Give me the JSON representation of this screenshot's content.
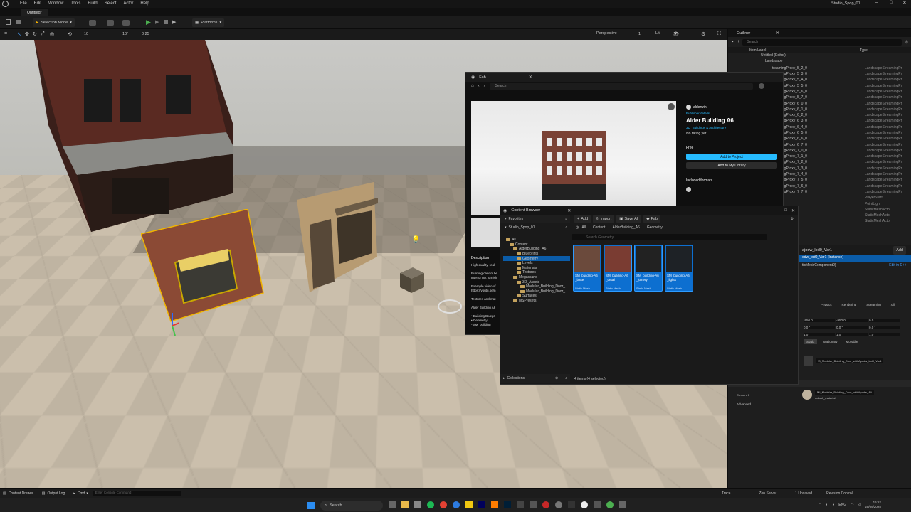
{
  "window": {
    "title": "Studio_Spop_01",
    "tab": "Untitled*"
  },
  "menu": [
    "File",
    "Edit",
    "Window",
    "Tools",
    "Build",
    "Select",
    "Actor",
    "Help"
  ],
  "toolbar": {
    "selection_mode": "Selection Mode",
    "platforms": "Platforms"
  },
  "viewport_toolbar": {
    "perspective": "Perspective",
    "lit": "Lit",
    "grid_snap": "10",
    "rot_snap": "10°",
    "scale_snap": "0.25",
    "camera_speed": "1"
  },
  "outliner": {
    "tab": "Outliner",
    "search_placeholder": "Search",
    "col_label": "Item Label",
    "col_type": "Type",
    "tree": [
      "Untitled (Editor)",
      "Landscape"
    ],
    "rows": [
      {
        "label": "treamingProxy_5_2_0",
        "type": "LandscapeStreamingPr"
      },
      {
        "label": "treamingProxy_5_3_0",
        "type": "LandscapeStreamingPr"
      },
      {
        "label": "treamingProxy_5_4_0",
        "type": "LandscapeStreamingPr"
      },
      {
        "label": "treamingProxy_5_5_0",
        "type": "LandscapeStreamingPr"
      },
      {
        "label": "treamingProxy_5_6_0",
        "type": "LandscapeStreamingPr"
      },
      {
        "label": "treamingProxy_5_7_0",
        "type": "LandscapeStreamingPr"
      },
      {
        "label": "treamingProxy_6_0_0",
        "type": "LandscapeStreamingPr"
      },
      {
        "label": "treamingProxy_6_1_0",
        "type": "LandscapeStreamingPr"
      },
      {
        "label": "treamingProxy_6_2_0",
        "type": "LandscapeStreamingPr"
      },
      {
        "label": "treamingProxy_6_3_0",
        "type": "LandscapeStreamingPr"
      },
      {
        "label": "treamingProxy_6_4_0",
        "type": "LandscapeStreamingPr"
      },
      {
        "label": "treamingProxy_6_5_0",
        "type": "LandscapeStreamingPr"
      },
      {
        "label": "treamingProxy_6_6_0",
        "type": "LandscapeStreamingPr"
      },
      {
        "label": "treamingProxy_6_7_0",
        "type": "LandscapeStreamingPr"
      },
      {
        "label": "treamingProxy_7_0_0",
        "type": "LandscapeStreamingPr"
      },
      {
        "label": "treamingProxy_7_1_0",
        "type": "LandscapeStreamingPr"
      },
      {
        "label": "treamingProxy_7_2_0",
        "type": "LandscapeStreamingPr"
      },
      {
        "label": "treamingProxy_7_3_0",
        "type": "LandscapeStreamingPr"
      },
      {
        "label": "treamingProxy_7_4_0",
        "type": "LandscapeStreamingPr"
      },
      {
        "label": "treamingProxy_7_5_0",
        "type": "LandscapeStreamingPr"
      },
      {
        "label": "treamingProxy_7_6_0",
        "type": "LandscapeStreamingPr"
      },
      {
        "label": "treamingProxy_7_7_0",
        "type": "LandscapeStreamingPr"
      },
      {
        "label": "",
        "type": "PlayerStart"
      },
      {
        "label": "",
        "type": "PointLight"
      },
      {
        "label": "ase",
        "type": "StaticMeshActor"
      },
      {
        "label": "etail",
        "type": "StaticMeshActor"
      },
      {
        "label": "oinery",
        "type": "StaticMeshActor"
      }
    ]
  },
  "details": {
    "title": "ajodw_lod0_Var1",
    "add": "Add",
    "instance": "odw_lod0_Var1 (Instance)",
    "component": "ticMeshComponent0)",
    "edit_cpp": "Edit in C++",
    "tabs": [
      "Physics",
      "Rendering",
      "Streaming",
      "All"
    ],
    "location": [
      "-950.0",
      "-950.0",
      "0.0"
    ],
    "rotation": [
      "0.0 °",
      "0.0 °",
      "0.0 °"
    ],
    "scale": [
      "1.0",
      "1.0",
      "1.0"
    ],
    "mobility": [
      "Static",
      "Stationary",
      "Movable"
    ],
    "mesh": "S_Modular_Building_Door_withApodw_lod0_Var1",
    "materials_header": "Materials",
    "element": "Element 0",
    "material": "MI_Modular_Building_Door_withApodw_Ali",
    "default_material": "default_material",
    "advanced": "Advanced"
  },
  "fab": {
    "title": "Fab",
    "search_placeholder": "Search",
    "publisher": "alderwin",
    "publisher_link": "Publisher details",
    "product": "Alder Building A6",
    "category_3d": "3D",
    "category": "Buildings & Architecture",
    "rating": "No rating yet",
    "price": "Free",
    "add_project": "Add to Project",
    "add_library": "Add to My Library",
    "included_formats": "Included formats",
    "desc_header": "Description",
    "desc_lines": [
      "High quality, reali",
      "",
      "Building cannot be",
      "Interior not furnish",
      "",
      "Example video of",
      "https://youtu.be/n",
      "",
      "Textures and mat",
      "",
      "Alder Building A6",
      "",
      "• Building Bluepr",
      "• Geometry:",
      "  - SM_building_"
    ]
  },
  "content_browser": {
    "title": "Content Browser",
    "add": "Add",
    "import": "Import",
    "save_all": "Save All",
    "fab": "Fab",
    "favorites": "Favorites",
    "project": "Studio_Spop_01",
    "breadcrumb": [
      "All",
      "Content",
      "AlderBuilding_A6",
      "Geometry"
    ],
    "search_placeholder": "Search Geometry",
    "tree": [
      {
        "label": "All",
        "depth": 0
      },
      {
        "label": "Content",
        "depth": 1
      },
      {
        "label": "AlderBuilding_A6",
        "depth": 2
      },
      {
        "label": "Blueprints",
        "depth": 3
      },
      {
        "label": "Geometry",
        "depth": 3,
        "selected": true
      },
      {
        "label": "Levels",
        "depth": 3
      },
      {
        "label": "Materials",
        "depth": 3
      },
      {
        "label": "Textures",
        "depth": 3
      },
      {
        "label": "Megascans",
        "depth": 2
      },
      {
        "label": "3D_Assets",
        "depth": 3
      },
      {
        "label": "Modular_Building_Door_",
        "depth": 4
      },
      {
        "label": "Modular_Building_Door_",
        "depth": 4
      },
      {
        "label": "Surfaces",
        "depth": 3
      },
      {
        "label": "MSPresets",
        "depth": 2
      }
    ],
    "assets": [
      {
        "name": "SM_building-A6 _base",
        "type": "Static Mesh"
      },
      {
        "name": "SM_building-A6 _detail",
        "type": "Static Mesh"
      },
      {
        "name": "SM_building-A6 _joinery",
        "type": "Static Mesh"
      },
      {
        "name": "SM_building-A6 _lights",
        "type": "Static Mesh"
      }
    ],
    "collections": "Collections",
    "status": "4 items (4 selected)"
  },
  "statusbar": {
    "content_drawer": "Content Drawer",
    "output_log": "Output Log",
    "cmd": "Cmd",
    "console_placeholder": "Enter Console Command",
    "trace": "Trace",
    "zen": "Zen Server",
    "unsaved": "1 Unsaved",
    "revision": "Revision Control"
  },
  "taskbar": {
    "search": "Search",
    "lang": "ENG",
    "time": "16:52",
    "date": "25/09/2025"
  },
  "colors": {
    "accent": "#26bbff",
    "selection": "#0d6fd0",
    "folder": "#c4a25d"
  }
}
